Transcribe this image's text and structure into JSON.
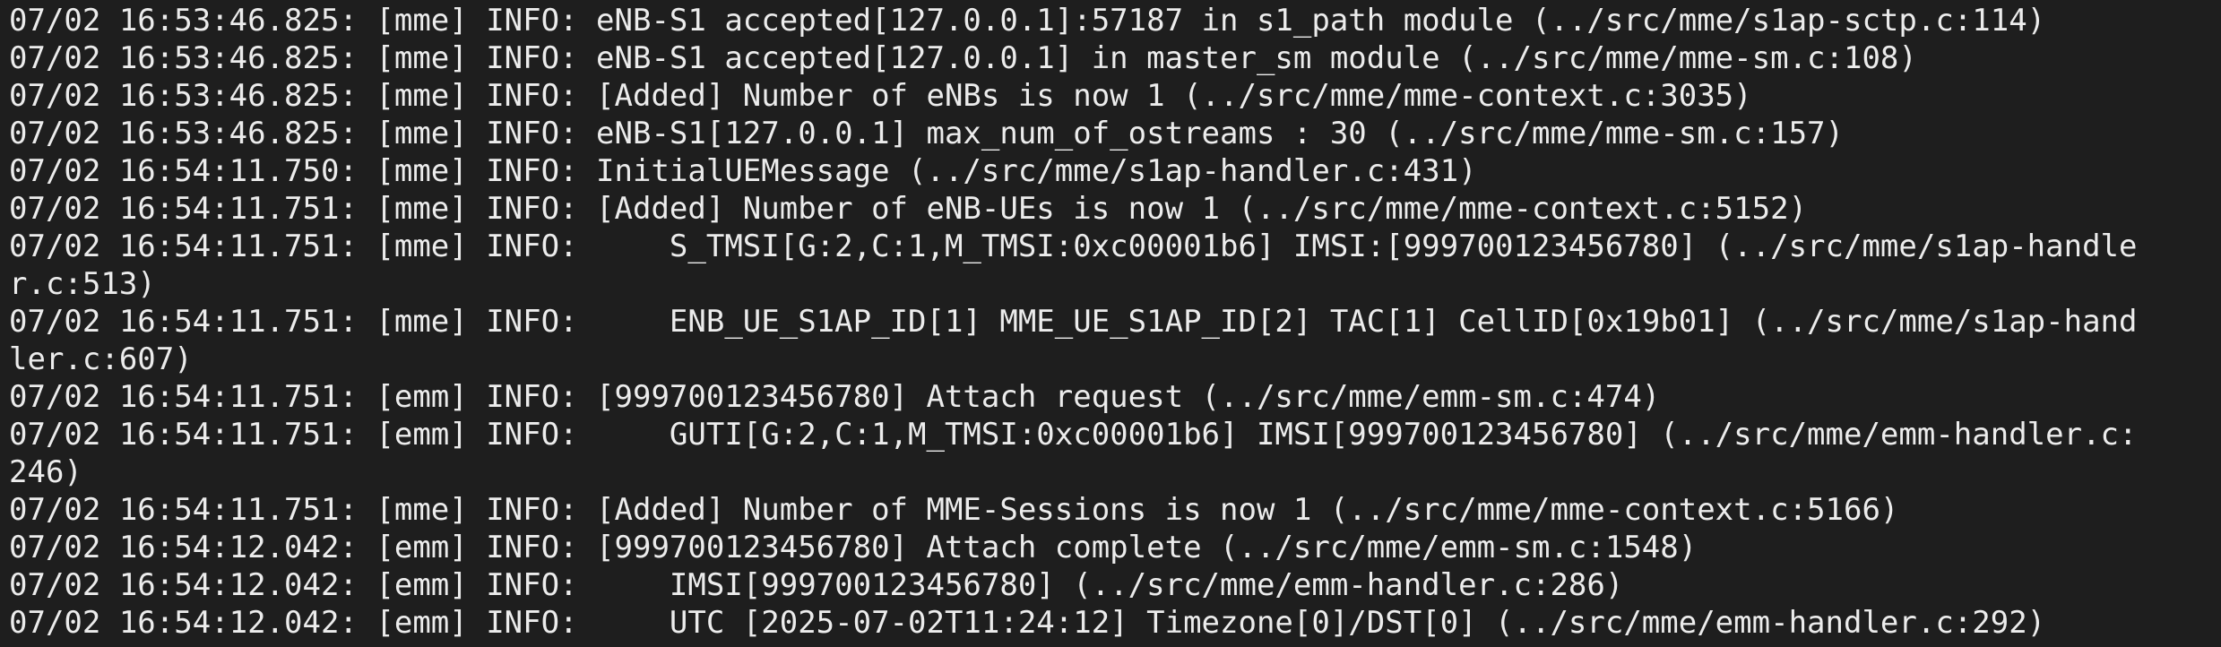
{
  "terminal": {
    "lines": [
      "07/02 16:53:46.825: [mme] INFO: eNB-S1 accepted[127.0.0.1]:57187 in s1_path module (../src/mme/s1ap-sctp.c:114)",
      "07/02 16:53:46.825: [mme] INFO: eNB-S1 accepted[127.0.0.1] in master_sm module (../src/mme/mme-sm.c:108)",
      "07/02 16:53:46.825: [mme] INFO: [Added] Number of eNBs is now 1 (../src/mme/mme-context.c:3035)",
      "07/02 16:53:46.825: [mme] INFO: eNB-S1[127.0.0.1] max_num_of_ostreams : 30 (../src/mme/mme-sm.c:157)",
      "07/02 16:54:11.750: [mme] INFO: InitialUEMessage (../src/mme/s1ap-handler.c:431)",
      "07/02 16:54:11.751: [mme] INFO: [Added] Number of eNB-UEs is now 1 (../src/mme/mme-context.c:5152)",
      "07/02 16:54:11.751: [mme] INFO:     S_TMSI[G:2,C:1,M_TMSI:0xc00001b6] IMSI:[999700123456780] (../src/mme/s1ap-handle",
      "r.c:513)",
      "07/02 16:54:11.751: [mme] INFO:     ENB_UE_S1AP_ID[1] MME_UE_S1AP_ID[2] TAC[1] CellID[0x19b01] (../src/mme/s1ap-hand",
      "ler.c:607)",
      "07/02 16:54:11.751: [emm] INFO: [999700123456780] Attach request (../src/mme/emm-sm.c:474)",
      "07/02 16:54:11.751: [emm] INFO:     GUTI[G:2,C:1,M_TMSI:0xc00001b6] IMSI[999700123456780] (../src/mme/emm-handler.c:",
      "246)",
      "07/02 16:54:11.751: [mme] INFO: [Added] Number of MME-Sessions is now 1 (../src/mme/mme-context.c:5166)",
      "07/02 16:54:12.042: [emm] INFO: [999700123456780] Attach complete (../src/mme/emm-sm.c:1548)",
      "07/02 16:54:12.042: [emm] INFO:     IMSI[999700123456780] (../src/mme/emm-handler.c:286)",
      "07/02 16:54:12.042: [emm] INFO:     UTC [2025-07-02T11:24:12] Timezone[0]/DST[0] (../src/mme/emm-handler.c:292)"
    ]
  }
}
